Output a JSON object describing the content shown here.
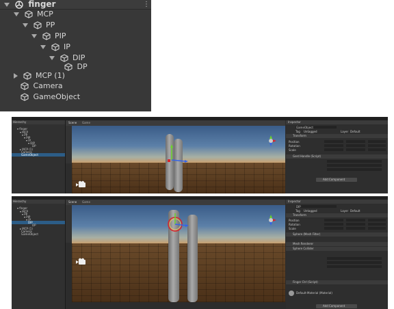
{
  "top_hierarchy": {
    "scene_name": "finger",
    "items": [
      {
        "label": "MCP",
        "expanded": true
      },
      {
        "label": "PP",
        "expanded": true
      },
      {
        "label": "PIP",
        "expanded": true
      },
      {
        "label": "IP",
        "expanded": true
      },
      {
        "label": "DIP",
        "expanded": true
      },
      {
        "label": "DP",
        "expanded": null
      },
      {
        "label": "MCP (1)",
        "expanded": false
      },
      {
        "label": "Camera",
        "expanded": null
      },
      {
        "label": "GameObject",
        "expanded": null
      }
    ]
  },
  "editor1": {
    "hierarchy_tab": "Hierarchy",
    "scene_tab": "Scene",
    "game_tab": "Game",
    "inspector_tab": "Inspector",
    "selected": "GameObject",
    "object_name": "GameObject",
    "tag": "Untagged",
    "layer": "Default",
    "transform": "Transform",
    "position": "Position",
    "rotation": "Rotation",
    "scale": "Scale",
    "component": "Gerd Handle (Script)",
    "add_component": "Add Component"
  },
  "editor2": {
    "selected": "DIP",
    "object_name": "DIP",
    "sphere": "Sphere (Mesh Filter)",
    "mesh_renderer": "Mesh Renderer",
    "sphere_collider": "Sphere Collider",
    "finger_ctrl": "Finger Ctrl (Script)",
    "material": "Default-Material (Material)",
    "add_component": "Add Component"
  }
}
